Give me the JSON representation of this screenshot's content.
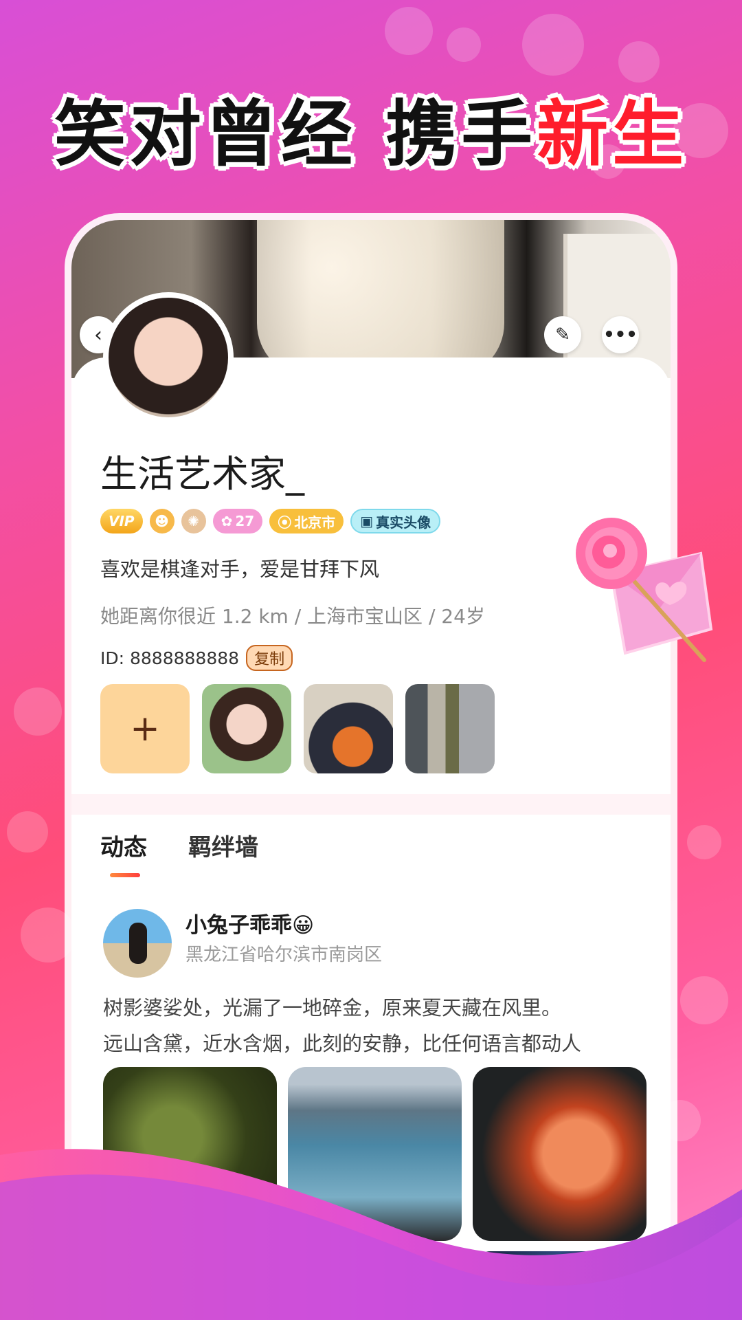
{
  "headline": {
    "part1": "笑对曾经 ",
    "part2": "携手",
    "part3": "新生"
  },
  "profile": {
    "name": "生活艺术家_",
    "badges": {
      "vip": "VIP",
      "level": "27",
      "city": "北京市",
      "real": "真实头像"
    },
    "bio": "喜欢是棋逢对手，爱是甘拜下风",
    "meta": "她距离你很近 1.2 km / 上海市宝山区 / 24岁",
    "id_label": "ID: 8888888888",
    "copy_label": "复制",
    "add_photo_symbol": "+"
  },
  "tabs": [
    {
      "label": "动态"
    },
    {
      "label": "羁绊墙"
    }
  ],
  "post": {
    "poster_name": "小兔子乖乖😀",
    "location": "黑龙江省哈尔滨市南岗区",
    "text_line1": "树影婆娑处，光漏了一地碎金，原来夏天藏在风里。",
    "text_line2": "远山含黛，近水含烟，此刻的安静，比任何语言都动人"
  },
  "icons": {
    "back": "back-icon",
    "edit": "edit-icon",
    "more": "more-icon"
  },
  "colors": {
    "accent": "#ff4d79",
    "headline_red": "#ff1d2c",
    "tab_indicator": "#ff5a3d"
  }
}
